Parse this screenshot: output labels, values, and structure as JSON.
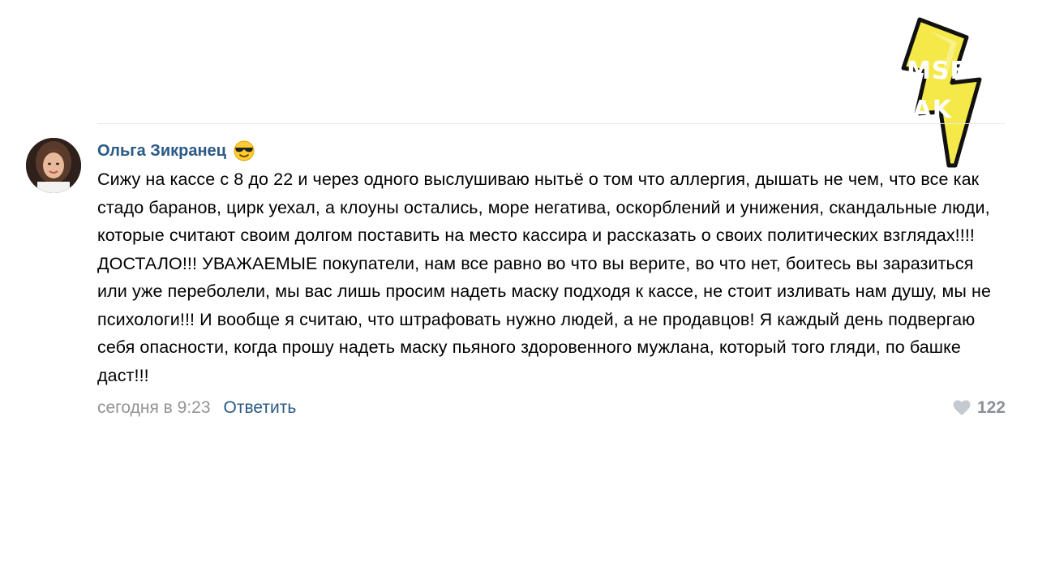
{
  "comment": {
    "author": "Ольга Зикранец",
    "author_emoji": "sunglasses-emoji",
    "text": "Сижу на кассе с 8 до 22 и через одного выслушиваю нытьё о том что аллергия, дышать не чем, что все как стадо баранов, цирк уехал, а клоуны остались, море негатива, оскорблений и унижения, скандальные люди, которые считают своим долгом поставить на место кассира и рассказать о своих политических взглядах!!!! ДОСТАЛО!!! УВАЖАЕМЫЕ покупатели, нам все равно во что вы верите, во что нет, боитесь вы заразиться или уже переболели, мы вас лишь просим надеть маску подходя к кассе, не стоит изливать нам душу, мы не психологи!!! И вообще я считаю, что штрафовать нужно людей, а не продавцов! Я каждый день подвергаю себя опасности, когда прошу надеть маску пьяного здоровенного мужлана, который того гляди, по башке даст!!!",
    "timestamp": "сегодня в 9:23",
    "reply_label": "Ответить",
    "likes": "122"
  },
  "watermark": {
    "line1": "MSE",
    "line2": "EAK"
  },
  "colors": {
    "link": "#2a5885",
    "muted": "#939393",
    "divider": "#e7e8ec",
    "watermark_yellow": "#f5e94a"
  }
}
